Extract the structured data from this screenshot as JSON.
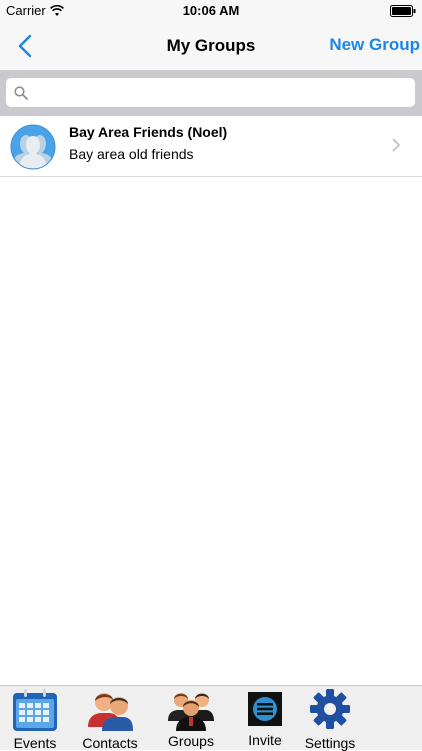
{
  "status_bar": {
    "carrier": "Carrier",
    "time": "10:06 AM"
  },
  "nav": {
    "title": "My Groups",
    "right_button": "New Group",
    "accent_color": "#1a86e6"
  },
  "search": {
    "placeholder": ""
  },
  "groups": [
    {
      "name": "Bay Area Friends (Noel)",
      "description": "Bay area old friends",
      "icon": "group-avatar-icon"
    }
  ],
  "tabs": [
    {
      "label": "Events",
      "icon": "calendar-icon"
    },
    {
      "label": "Contacts",
      "icon": "contacts-icon"
    },
    {
      "label": "Groups",
      "icon": "groups-icon"
    },
    {
      "label": "Invite",
      "icon": "invite-icon"
    },
    {
      "label": "Settings",
      "icon": "gear-icon"
    }
  ]
}
